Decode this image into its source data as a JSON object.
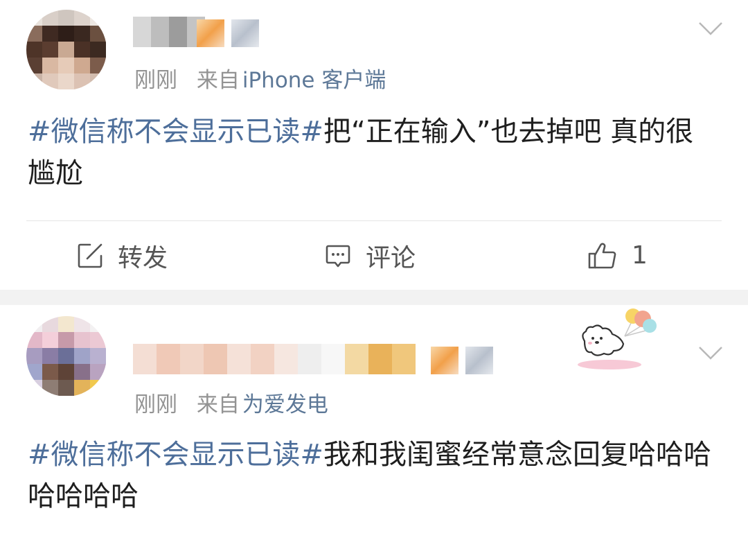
{
  "posts": [
    {
      "time": "刚刚",
      "source_prefix": "来自",
      "source": "iPhone 客户端",
      "hashtag": "#微信称不会显示已读#",
      "text": "把“正在输入”也去掉吧 真的很尴尬",
      "actions": {
        "repost": "转发",
        "comment": "评论",
        "like_count": "1"
      }
    },
    {
      "time": "刚刚",
      "source_prefix": "来自",
      "source": "为爱发电",
      "hashtag": "#微信称不会显示已读#",
      "text": "我和我闺蜜经常意念回复哈哈哈哈哈哈哈"
    }
  ],
  "icons": {
    "repost": "edit-square-icon",
    "comment": "comment-bubble-icon",
    "like": "thumbs-up-icon",
    "more": "chevron-down-icon"
  },
  "colors": {
    "hashtag": "#4d6e9a",
    "source_link": "#5d7897",
    "meta_text": "#939393",
    "body_text": "#1e1e1e",
    "separator": "#f2f2f2"
  }
}
